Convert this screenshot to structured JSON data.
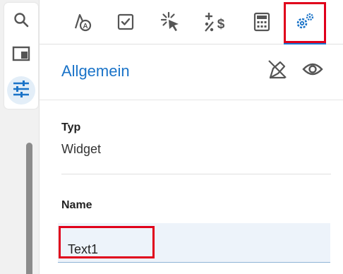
{
  "colors": {
    "accent": "#1a73c8",
    "highlight": "#e0001b",
    "icon": "#555555",
    "input_bg": "#edf3fa"
  },
  "rail": {
    "items": [
      {
        "icon": "search-icon"
      },
      {
        "icon": "panel-icon"
      },
      {
        "icon": "sliders-icon",
        "active": true
      }
    ]
  },
  "tabs": [
    {
      "icon": "font-style-icon"
    },
    {
      "icon": "checkbox-icon"
    },
    {
      "icon": "click-icon"
    },
    {
      "icon": "plus-minus-currency-icon"
    },
    {
      "icon": "calculator-icon"
    },
    {
      "icon": "settings-gear-icon",
      "selected": true
    }
  ],
  "section": {
    "title": "Allgemein",
    "actions": [
      {
        "icon": "eye-crossed-pen-icon"
      },
      {
        "icon": "eye-icon"
      }
    ]
  },
  "fields": {
    "type_label": "Typ",
    "type_value": "Widget",
    "name_label": "Name",
    "name_value": "Text1"
  }
}
